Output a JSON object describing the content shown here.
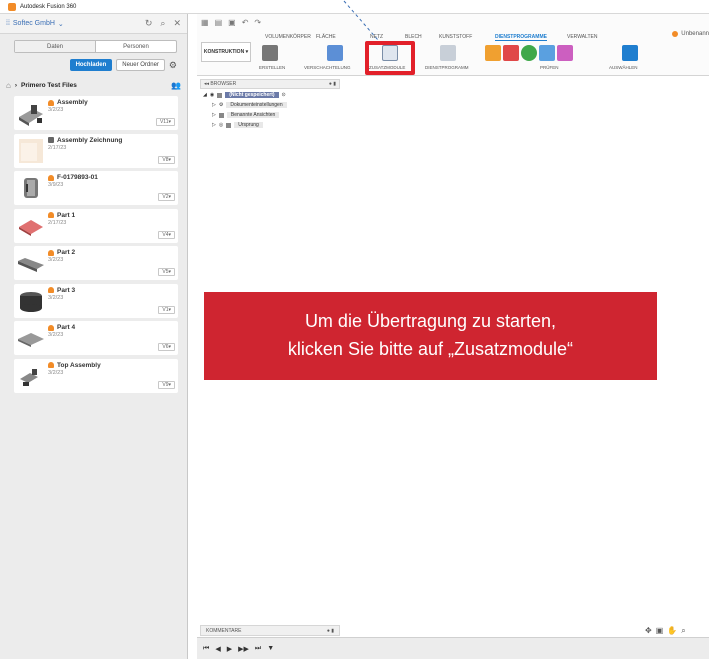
{
  "window": {
    "title": "Autodesk Fusion 360",
    "doc_tab": "Unbenann"
  },
  "sidebar": {
    "team": "Softec GmbH",
    "tabs": [
      "Daten",
      "Personen"
    ],
    "upload_label": "Hochladen",
    "new_folder_label": "Neuer Ordner",
    "project": "Primero Test Files",
    "files": [
      {
        "name": "Assembly",
        "date": "3/2/23",
        "version": "V11"
      },
      {
        "name": "Assembly Zeichnung",
        "date": "2/17/23",
        "version": "V8"
      },
      {
        "name": "F-0179893-01",
        "date": "3/9/23",
        "version": "V2"
      },
      {
        "name": "Part 1",
        "date": "2/17/23",
        "version": "V4"
      },
      {
        "name": "Part 2",
        "date": "3/2/23",
        "version": "V5"
      },
      {
        "name": "Part 3",
        "date": "3/2/23",
        "version": "V1"
      },
      {
        "name": "Part 4",
        "date": "3/2/23",
        "version": "V6"
      },
      {
        "name": "Top Assembly",
        "date": "3/2/23",
        "version": "V9"
      }
    ]
  },
  "ribbon": {
    "tabs": [
      "VOLUMENKÖRPER",
      "FLÄCHE",
      "NETZ",
      "BLECH",
      "KUNSTSTOFF",
      "DIENSTPROGRAMME",
      "VERWALTEN"
    ],
    "active_tab": "DIENSTPROGRAMME",
    "workspace": "KONSTRUKTION",
    "groups": [
      "ERSTELLEN",
      "VERSCHACHTELUNG",
      "ZUSATZMODULE",
      "DIENSTPROGRAMM",
      "PRÜFEN",
      "AUSWÄHLEN"
    ]
  },
  "browser": {
    "label": "BROWSER",
    "root": "(Nicht gespeichert)",
    "items": [
      "Dokumenteinstellungen",
      "Benannte Ansichten",
      "Ursprung"
    ]
  },
  "comments": {
    "label": "KOMMENTARE"
  },
  "banner": {
    "line1": "Um die Übertragung zu starten,",
    "line2": "klicken Sie bitte auf „Zusatzmodule“"
  },
  "colors": {
    "accent": "#1f7ecf",
    "highlight": "#e2202a",
    "banner": "#cf2530"
  }
}
